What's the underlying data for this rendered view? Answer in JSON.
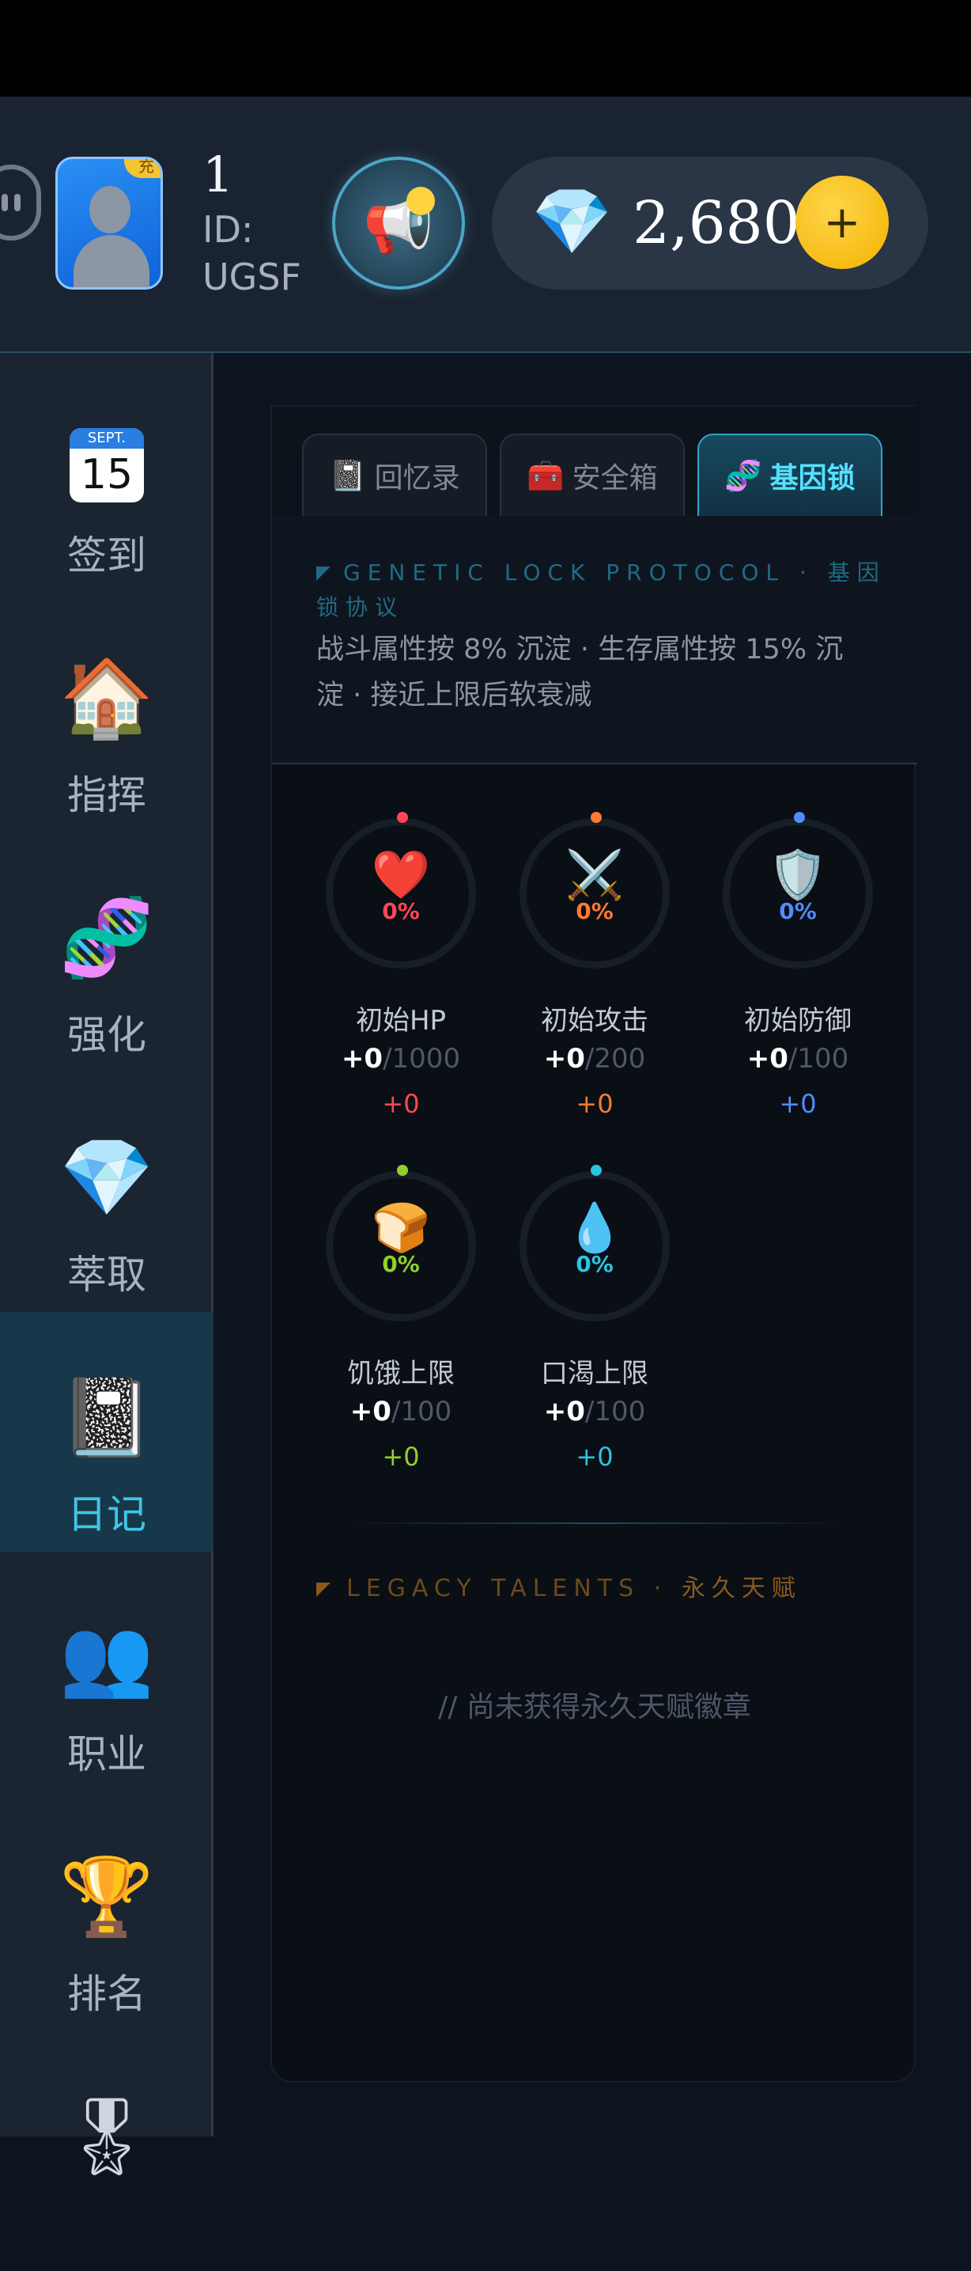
{
  "header": {
    "level": "1",
    "user_id": "ID: UGSF",
    "avatar_badge": "充",
    "gem_count": "2,680",
    "add_label": "+"
  },
  "sidebar": {
    "items": [
      {
        "label": "签到",
        "icon": "calendar-icon",
        "calendar_month": "SEPT.",
        "calendar_day": "15"
      },
      {
        "label": "指挥",
        "icon": "house-icon"
      },
      {
        "label": "强化",
        "icon": "dna-icon"
      },
      {
        "label": "萃取",
        "icon": "gem-icon"
      },
      {
        "label": "日记",
        "icon": "notebook-icon",
        "active": true
      },
      {
        "label": "职业",
        "icon": "people-icon"
      },
      {
        "label": "排名",
        "icon": "trophy-icon"
      }
    ]
  },
  "tabs": [
    {
      "label": "回忆录",
      "icon": "book-icon"
    },
    {
      "label": "安全箱",
      "icon": "toolbox-icon"
    },
    {
      "label": "基因锁",
      "icon": "dna-icon",
      "active": true
    }
  ],
  "protocol": {
    "title_en": "GENETIC LOCK PROTOCOL ·",
    "title_cn": "基因锁协议",
    "description": "战斗属性按 8% 沉淀 · 生存属性按 15% 沉淀 · 接近上限后软衰减"
  },
  "stats": [
    {
      "name": "初始HP",
      "percent": "0%",
      "current": "+0",
      "max": "1000",
      "bonus": "+0",
      "color": "#ff4757",
      "icon": "heart-icon"
    },
    {
      "name": "初始攻击",
      "percent": "0%",
      "current": "+0",
      "max": "200",
      "bonus": "+0",
      "color": "#ff7a2e",
      "icon": "swords-icon"
    },
    {
      "name": "初始防御",
      "percent": "0%",
      "current": "+0",
      "max": "100",
      "bonus": "+0",
      "color": "#4f8cff",
      "icon": "shield-icon"
    },
    {
      "name": "饥饿上限",
      "percent": "0%",
      "current": "+0",
      "max": "100",
      "bonus": "+0",
      "color": "#8fd12a",
      "icon": "bread-icon"
    },
    {
      "name": "口渴上限",
      "percent": "0%",
      "current": "+0",
      "max": "100",
      "bonus": "+0",
      "color": "#29c6e0",
      "icon": "water-drop-icon"
    }
  ],
  "legacy": {
    "title_en": "LEGACY TALENTS ·",
    "title_cn": "永久天赋",
    "empty": "// 尚未获得永久天赋徽章"
  }
}
